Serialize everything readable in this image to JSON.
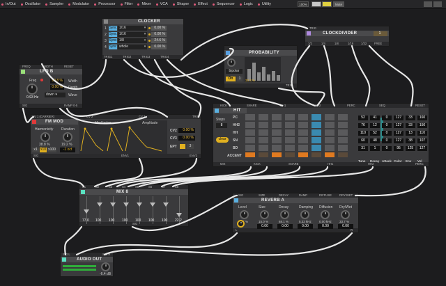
{
  "menu": {
    "items": [
      "In/Out",
      "Oscillator",
      "Sampler",
      "Modulator",
      "Processor",
      "Filter",
      "Mixer",
      "VCA",
      "Shaper",
      "Effect",
      "Sequencer",
      "Logic",
      "Utility"
    ],
    "zoom": "100%",
    "mute": "Mute"
  },
  "clocker": {
    "title": "CLOCKER",
    "rows": [
      {
        "n": "1",
        "mode": "Sync",
        "div": "1/16",
        "val": "0.00 %"
      },
      {
        "n": "2",
        "mode": "Sync",
        "div": "1/16",
        "val": "0.00 %"
      },
      {
        "n": "3",
        "mode": "Sync",
        "div": "1/8",
        "val": "24.6 %"
      },
      {
        "n": "4",
        "mode": "Sync",
        "div": "whole",
        "val": "0.00 %"
      }
    ],
    "outs": [
      "TRIG1",
      "TRIG2",
      "TRIG3",
      "TRIG4"
    ]
  },
  "clockdivider": {
    "title": "CLOCKDIVIDER",
    "in": "TRIG",
    "value": "1",
    "outs": [
      "1/2",
      "1/4",
      "1/8",
      "1/16",
      "1/32",
      "FREE"
    ]
  },
  "probability": {
    "title": "PROBABILITY",
    "mode": "bipolar",
    "toggle": "On",
    "num": "1",
    "pct": "33.3 %",
    "out": "TRIG",
    "bars": [
      0.55,
      0.85,
      0.4,
      0.65,
      0.3,
      0.45,
      0.25
    ]
  },
  "lfo": {
    "title": "LFO B",
    "ports": [
      "FREQ",
      "WIDTH",
      "RESET"
    ],
    "freq_label": "Freq",
    "freq_value": "0.93 Hz",
    "width_value": "99.8 %",
    "depth_value": "0.00 %",
    "width_label": "Width",
    "depth_label": "Depth",
    "wave": "down",
    "wave_label": "Wave",
    "outs": [
      "SIG",
      "RAMP 0-5"
    ]
  },
  "fm": {
    "title": "FM MOD",
    "ports": [
      "CV 1 (CARRIER)",
      "CV 2",
      "CV 3",
      "TRIG"
    ],
    "harm_label": "Harmonicity",
    "dur_label": "Duration",
    "harm_value": "38.8 %",
    "dur_value": "19.2 %",
    "mod_label": "Mod Index",
    "amp_label": "Amplitude",
    "cv2_label": "CV2",
    "cv2_value": "0.00 %",
    "cv3_label": "CV3",
    "cv3_value": "0.00 %",
    "ept_label": "EPT",
    "ept_value": "3",
    "xs": [
      "x1",
      "x10",
      "x100"
    ],
    "small": "-1 oct",
    "outs": [
      "SIG",
      "ENV1",
      "ENV2"
    ]
  },
  "hit": {
    "title": "HIT",
    "ports": [
      "KICK",
      "SNARE",
      "HH1",
      "HH2",
      "PERC",
      "SEQ",
      "RESET"
    ],
    "steps_label": "Steps",
    "steps_value": "8",
    "clear": "clear",
    "rows": [
      "PC",
      "HH2",
      "HH",
      "SN",
      "BD",
      "ACCENT"
    ],
    "grid": [
      [
        0,
        0,
        0,
        0,
        0,
        1,
        0,
        0
      ],
      [
        0,
        0,
        0,
        0,
        0,
        1,
        0,
        0
      ],
      [
        0,
        0,
        0,
        0,
        0,
        1,
        0,
        0
      ],
      [
        0,
        0,
        0,
        0,
        0,
        1,
        0,
        0
      ],
      [
        0,
        0,
        0,
        0,
        0,
        1,
        0,
        0
      ],
      [
        1,
        0,
        1,
        0,
        1,
        0,
        1,
        0
      ]
    ],
    "params": [
      [
        "52",
        "41",
        "0",
        "127",
        "33",
        "160"
      ],
      [
        "76",
        "12",
        "0",
        "127",
        "33",
        "150"
      ],
      [
        "110",
        "52",
        "0",
        "127",
        "13",
        "110"
      ],
      [
        "60",
        "48",
        "0",
        "127",
        "38",
        "107"
      ],
      [
        "31",
        "1",
        "0",
        "95",
        "125",
        "127"
      ]
    ],
    "param_labels": [
      "Tune",
      "Decay",
      "Attack",
      "Color",
      "Env",
      "Vol"
    ],
    "outs": [
      "MIX",
      "KICK",
      "SNARE",
      "HH1",
      "HH2",
      "PERC"
    ]
  },
  "mix": {
    "title": "MIX 8",
    "ins": [
      "S1",
      "S2",
      "S3",
      "S4",
      "S5",
      "S6",
      "S7",
      "S8"
    ],
    "values": [
      "77.0",
      "100",
      "100",
      "100",
      "100",
      "100",
      "100",
      "22.2"
    ],
    "fader_pos": [
      0.55,
      0.25,
      0.25,
      0.25,
      0.25,
      0.25,
      0.25,
      0.7
    ],
    "out": "SIG"
  },
  "reverb": {
    "title": "REVERB A",
    "ports": [
      "SIG",
      "SIZE",
      "DECAY",
      "DAMP",
      "DIFFUSE",
      "DRY/WET"
    ],
    "labels": [
      "Level",
      "Size",
      "Decay",
      "Damping",
      "Diffusion",
      "Dry/Wet"
    ],
    "knob_values": [
      "33.7 %",
      "15.0 %",
      "68.1 %",
      "5.32 kHz",
      "0.00 kHz",
      "33.7 %"
    ],
    "box_values": [
      "",
      "0.00",
      "0.00",
      "0.00",
      "0.00",
      "0.00"
    ],
    "outs": [
      "L",
      "R"
    ]
  },
  "audio": {
    "title": "AUDIO OUT",
    "ins": [
      "SIG L",
      "SIG R"
    ],
    "level": "-6.4 dB"
  },
  "colors": {
    "accent": "#f0c040",
    "lfo": "#9ae07a",
    "fm_red": "#e03a3a",
    "hit_blue": "#5ab0e0",
    "clockdiv": "#b08ae0",
    "mix": "#5ae0c0",
    "probability": "#5aa0e0",
    "grid_on": "#e07a20",
    "reverb": "#5ab0e0"
  }
}
